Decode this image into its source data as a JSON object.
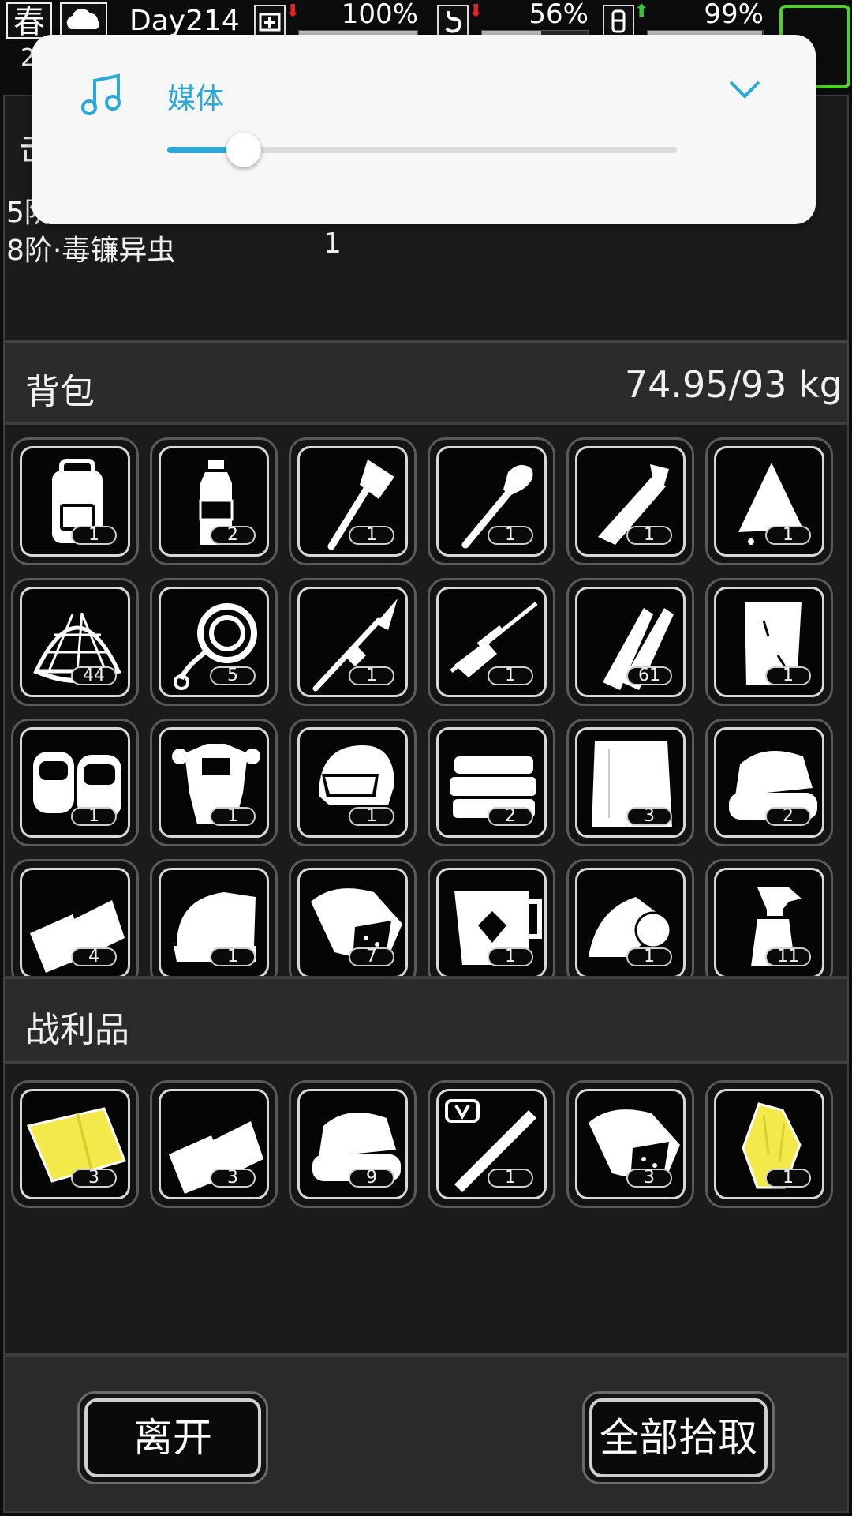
{
  "status": {
    "season": "春",
    "day": "Day214",
    "health": {
      "label": "100%",
      "value": 1.0,
      "trend": "down"
    },
    "hunger": {
      "label": "56%",
      "value": 0.56,
      "trend": "down"
    },
    "thirst": {
      "label": "99%",
      "value": 0.99,
      "trend": "up"
    },
    "corner_count": "2"
  },
  "enemies": {
    "rows": [
      {
        "name": "5阶",
        "count": ""
      },
      {
        "name": "8阶·毒镰异虫",
        "count": "1"
      }
    ]
  },
  "backpack": {
    "title": "背包",
    "weight": "74.95/93 kg"
  },
  "backpack_items": [
    {
      "icon": "backpack-icon",
      "qty": "1"
    },
    {
      "icon": "water-bottle-icon",
      "qty": "2"
    },
    {
      "icon": "axe-icon",
      "qty": "1"
    },
    {
      "icon": "shovel-icon",
      "qty": "1"
    },
    {
      "icon": "wrench-blade-icon",
      "qty": "1"
    },
    {
      "icon": "torn-cloth-icon",
      "qty": "1"
    },
    {
      "icon": "net-icon",
      "qty": "44"
    },
    {
      "icon": "rope-icon",
      "qty": "5"
    },
    {
      "icon": "spear-icon",
      "qty": "1"
    },
    {
      "icon": "sniper-rifle-icon",
      "qty": "1"
    },
    {
      "icon": "bullets-icon",
      "qty": "61"
    },
    {
      "icon": "paper-icon",
      "qty": "1"
    },
    {
      "icon": "knee-pads-icon",
      "qty": "1"
    },
    {
      "icon": "body-armor-icon",
      "qty": "1"
    },
    {
      "icon": "helmet-icon",
      "qty": "1"
    },
    {
      "icon": "cloth-stack-icon",
      "qty": "2"
    },
    {
      "icon": "cloth-sheet-icon",
      "qty": "3"
    },
    {
      "icon": "folded-towel-icon",
      "qty": "2"
    },
    {
      "icon": "fabric-icon",
      "qty": "4"
    },
    {
      "icon": "towel-icon",
      "qty": "1"
    },
    {
      "icon": "ore-sack-icon",
      "qty": "7"
    },
    {
      "icon": "herbal-jug-icon",
      "qty": "1"
    },
    {
      "icon": "bandage-roll-icon",
      "qty": "1"
    },
    {
      "icon": "spray-bottle-icon",
      "qty": "11"
    }
  ],
  "loot": {
    "title": "战利品"
  },
  "loot_items": [
    {
      "icon": "yellow-cloth-icon",
      "qty": "3"
    },
    {
      "icon": "fabric-icon",
      "qty": "3"
    },
    {
      "icon": "folded-towel-icon",
      "qty": "9"
    },
    {
      "icon": "vitamin-vial-icon",
      "qty": "1"
    },
    {
      "icon": "ore-sack-icon",
      "qty": "3"
    },
    {
      "icon": "yellow-crystal-icon",
      "qty": "1"
    }
  ],
  "buttons": {
    "leave": "离开",
    "pick_all": "全部拾取"
  },
  "volume": {
    "label": "媒体",
    "level": 0.15,
    "accent": "#2aa8d8"
  }
}
